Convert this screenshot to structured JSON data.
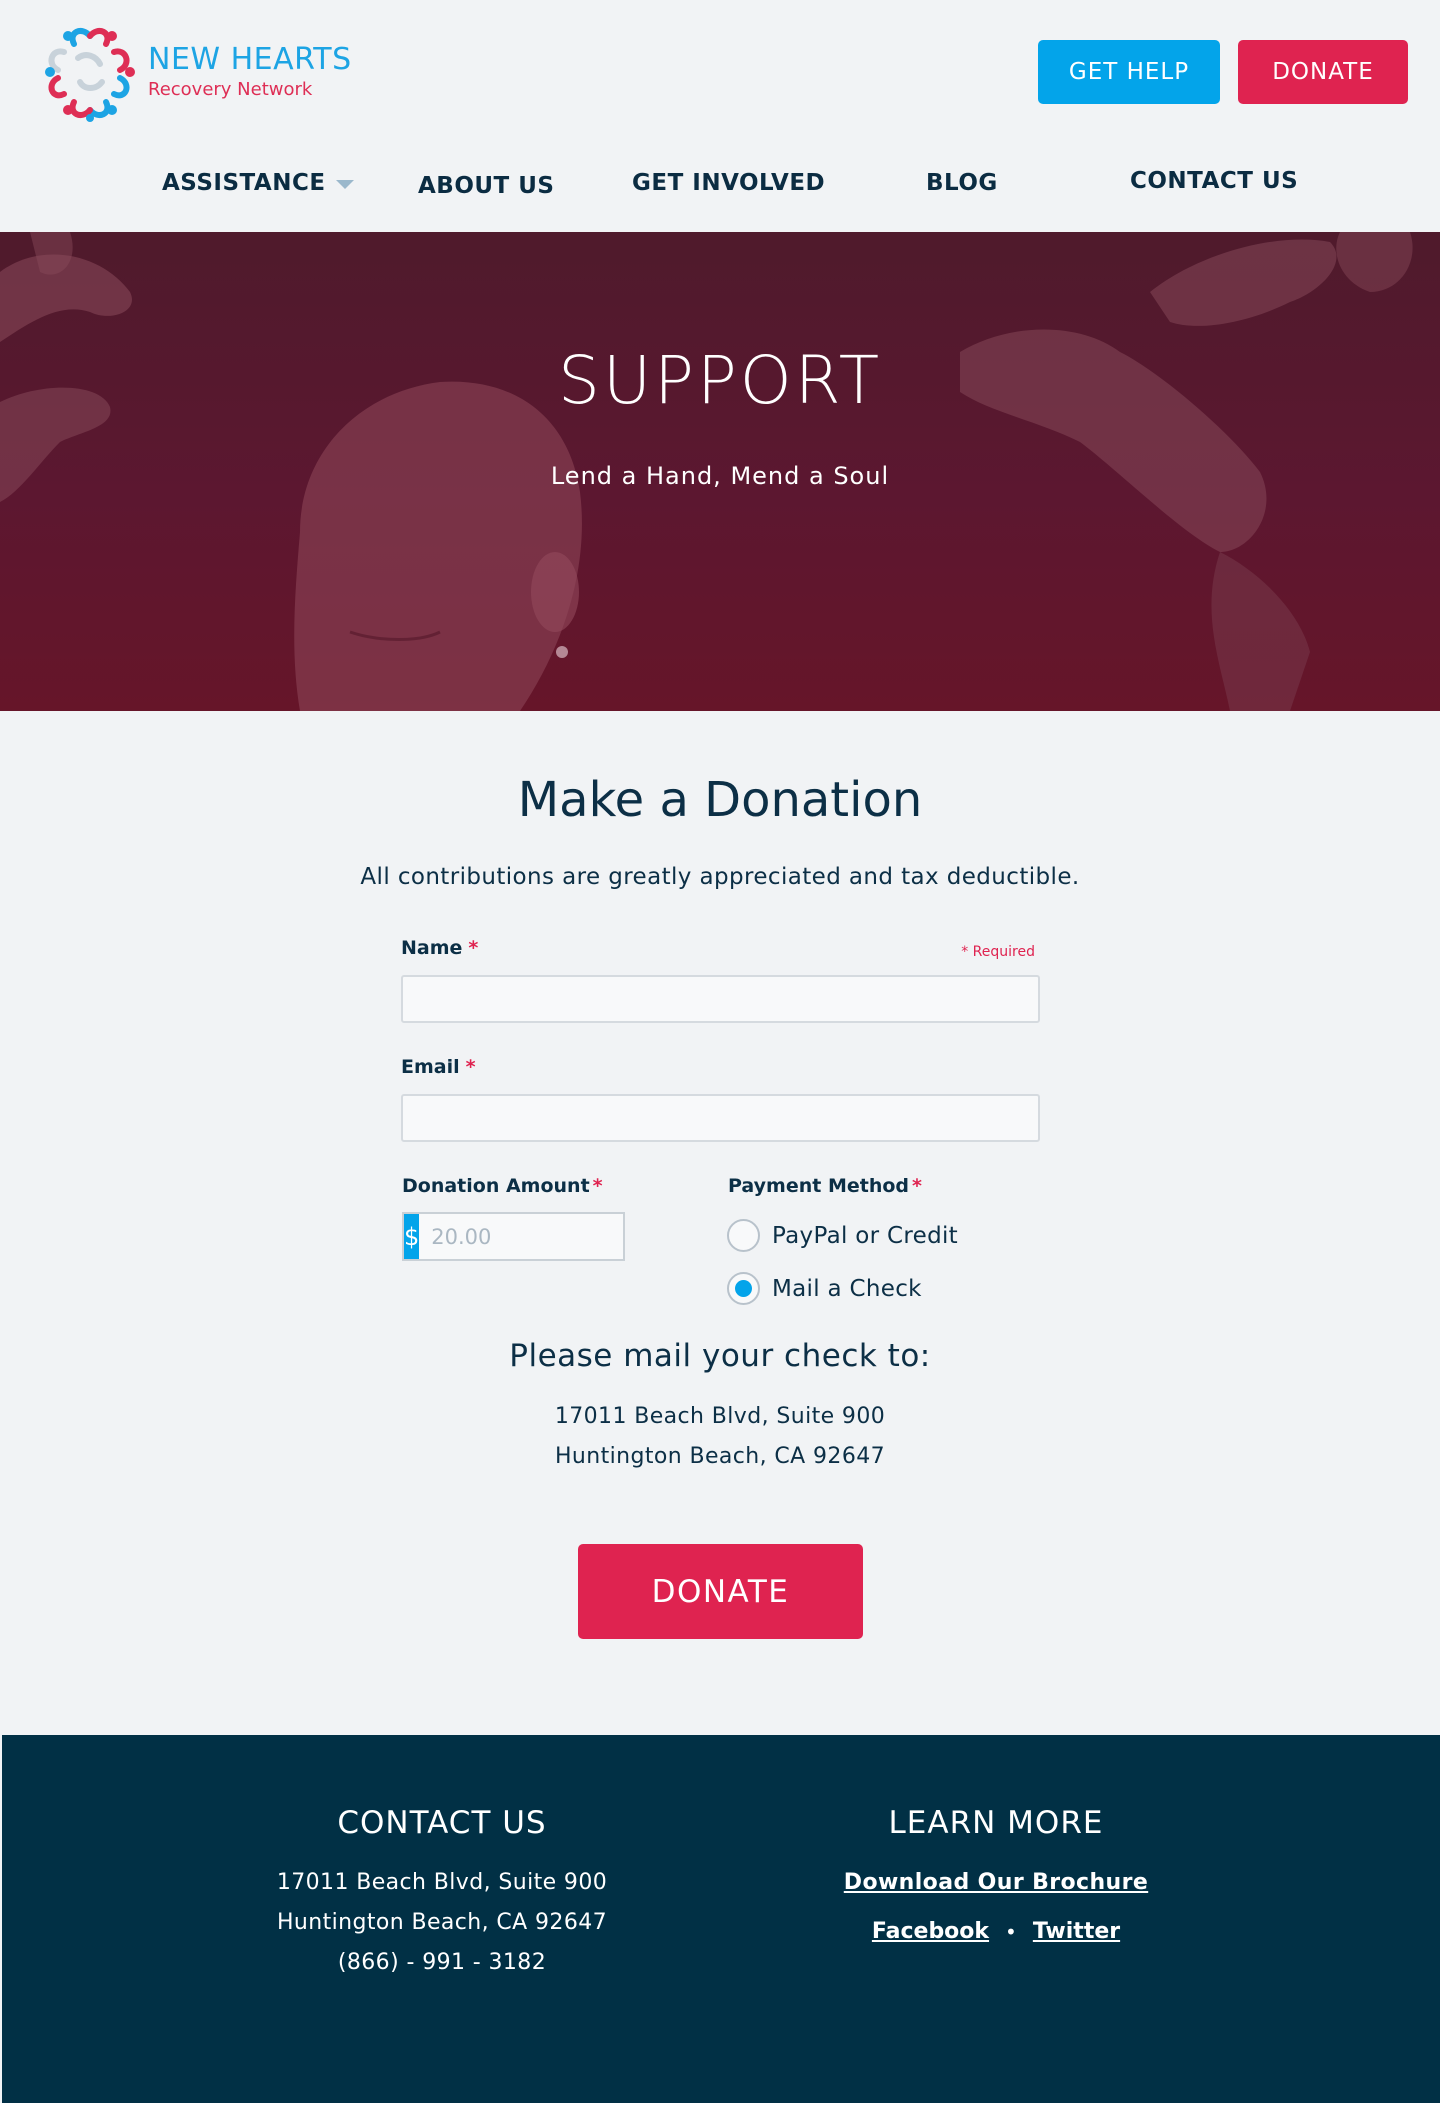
{
  "brand": {
    "name": "NEW HEARTS",
    "tagline": "Recovery Network",
    "colors": {
      "primary_blue": "#03a4ea",
      "accent_red": "#df2350",
      "navy": "#013045"
    }
  },
  "header": {
    "get_help_label": "GET HELP",
    "donate_label": "DONATE"
  },
  "nav": {
    "items": [
      {
        "label": "ASSISTANCE",
        "has_dropdown": true
      },
      {
        "label": "ABOUT US"
      },
      {
        "label": "GET INVOLVED"
      },
      {
        "label": "BLOG"
      },
      {
        "label": "CONTACT US"
      }
    ]
  },
  "hero": {
    "title": "SUPPORT",
    "subtitle": "Lend a Hand, Mend a Soul"
  },
  "form": {
    "title": "Make a Donation",
    "intro": "All contributions are greatly appreciated and tax deductible.",
    "required_note": "* Required",
    "name_label": "Name",
    "name_value": "",
    "email_label": "Email",
    "email_value": "",
    "amount_label": "Donation Amount",
    "amount_prefix": "$",
    "amount_placeholder": "20.00",
    "amount_value": "",
    "payment_label": "Payment Method",
    "payment_options": [
      {
        "label": "PayPal or Credit",
        "selected": false
      },
      {
        "label": "Mail a Check",
        "selected": true
      }
    ],
    "required_star": "*"
  },
  "mail": {
    "heading": "Please mail your check to:",
    "address_line1": "17011 Beach Blvd, Suite 900",
    "address_line2": "Huntington Beach, CA 92647"
  },
  "donate_button_label": "DONATE",
  "footer": {
    "contact_heading": "CONTACT US",
    "contact_line1": "17011 Beach Blvd, Suite 900",
    "contact_line2": "Huntington Beach, CA 92647",
    "contact_phone": "(866) - 991 - 3182",
    "learn_heading": "LEARN MORE",
    "brochure_link": "Download Our Brochure",
    "facebook_link": "Facebook",
    "separator": "•",
    "twitter_link": "Twitter"
  }
}
